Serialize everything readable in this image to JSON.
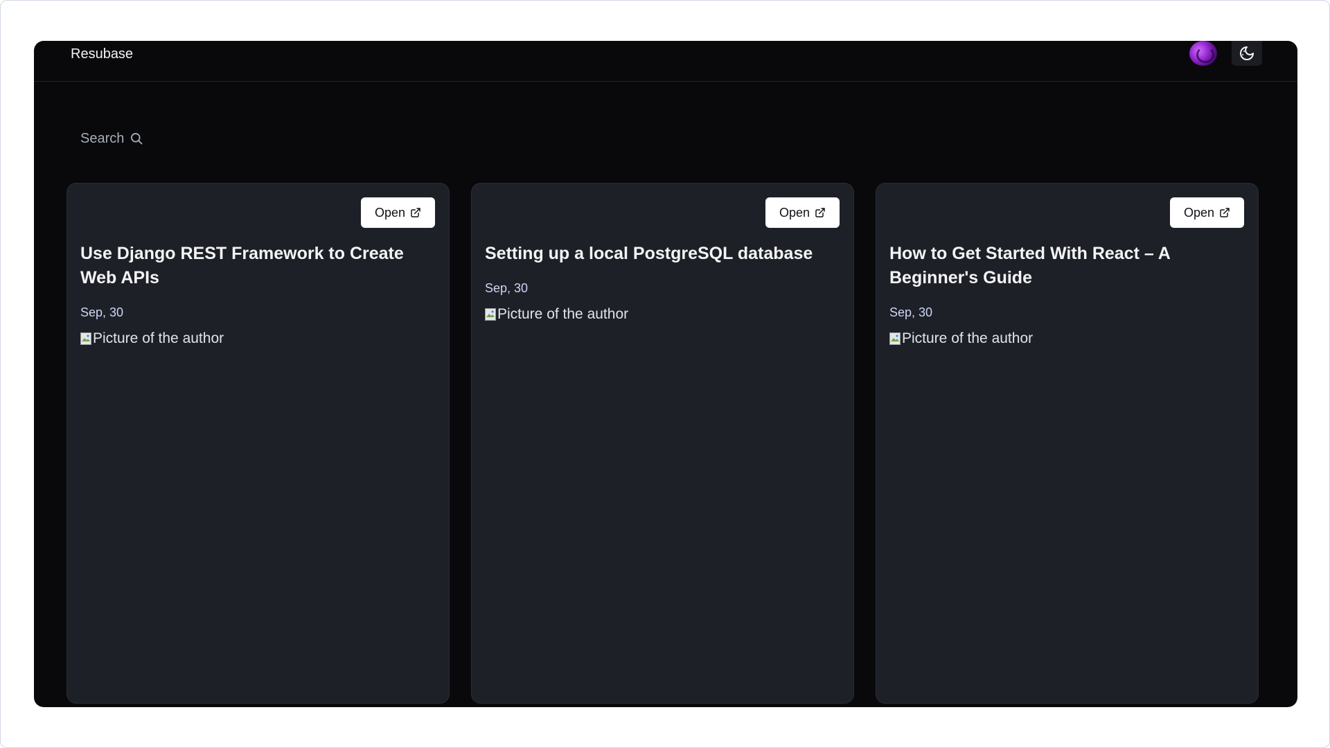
{
  "app": {
    "brand": "Resubase",
    "search_label": "Search"
  },
  "icons": {
    "search": "search-icon",
    "open": "external-link-icon",
    "theme": "moon-sun-icon",
    "broken_image": "broken-image-icon"
  },
  "colors": {
    "app_background": "#09090b",
    "card_background": "#1e2028",
    "button_background": "#ffffff",
    "date_text": "#cdd6f4",
    "avatar_accent": "#8a1fc7"
  },
  "cards": [
    {
      "open_label": "Open",
      "title_line1": "Use Django REST Framework to Create",
      "title_line2": "Web APIs",
      "date": "Sep, 30",
      "author_alt": "Picture of the author"
    },
    {
      "open_label": "Open",
      "title_line1": "Setting up a local PostgreSQL database",
      "title_line2": "",
      "date": "Sep, 30",
      "author_alt": "Picture of the author"
    },
    {
      "open_label": "Open",
      "title_line1": "How to Get Started With React – A",
      "title_line2": "Beginner's Guide",
      "date": "Sep, 30",
      "author_alt": "Picture of the author"
    }
  ]
}
